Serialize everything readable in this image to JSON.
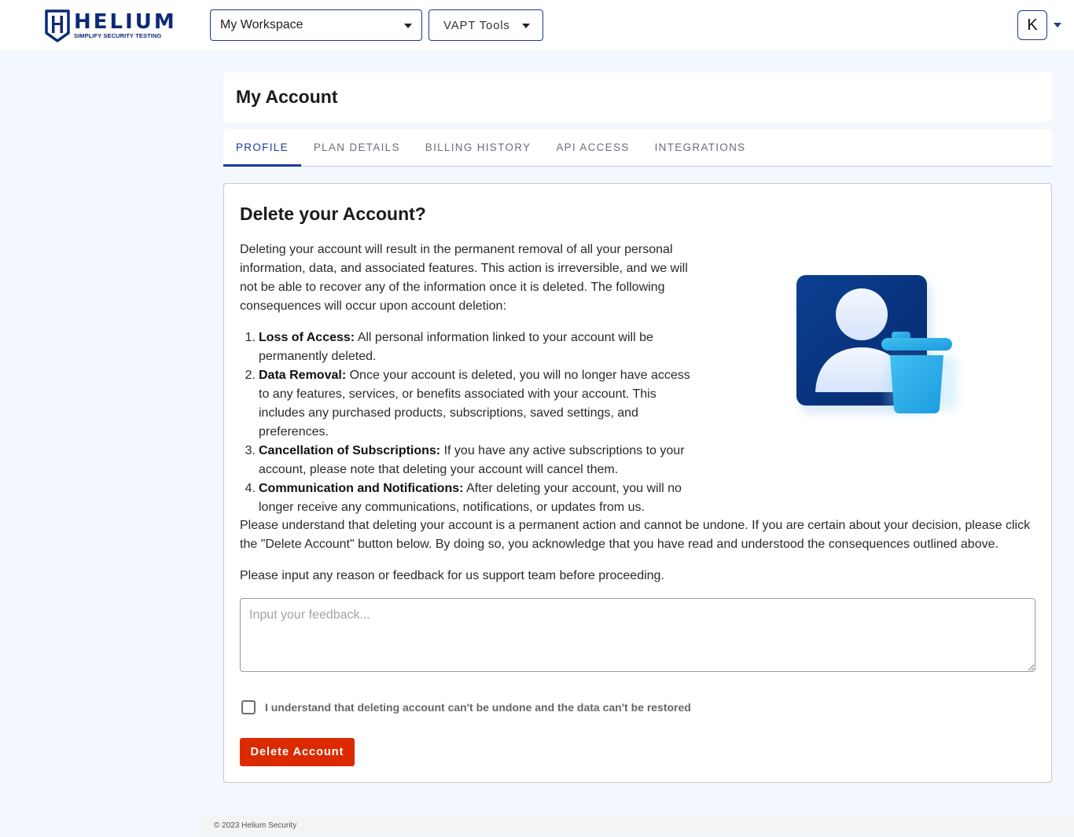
{
  "brand": {
    "name": "HELIUM",
    "tagline": "SIMPLIFY SECURITY TESTING",
    "primary_color": "#0d2a78"
  },
  "header": {
    "workspace_select": {
      "value": "My Workspace"
    },
    "tools_select": {
      "value": "VAPT Tools"
    },
    "user_avatar": {
      "initial": "K"
    }
  },
  "page": {
    "title": "My Account",
    "tabs": [
      {
        "label": "PROFILE",
        "active": true
      },
      {
        "label": "PLAN DETAILS",
        "active": false
      },
      {
        "label": "BILLING HISTORY",
        "active": false
      },
      {
        "label": "API ACCESS",
        "active": false
      },
      {
        "label": "INTEGRATIONS",
        "active": false
      }
    ]
  },
  "delete_section": {
    "title": "Delete your Account?",
    "intro": "Deleting your account will result in the permanent removal of all your personal information, data, and associated features. This action is irreversible, and we will not be able to recover any of the information once it is deleted. The following consequences will occur upon account deletion:",
    "consequences": [
      {
        "num": "1.",
        "heading": "Loss of Access:",
        "text": " All personal information linked to your account will be permanently deleted."
      },
      {
        "num": "2.",
        "heading": "Data Removal:",
        "text": " Once your account is deleted, you will no longer have access to any features, services, or benefits associated with your account. This includes any purchased products, subscriptions, saved settings, and preferences."
      },
      {
        "num": "3.",
        "heading": "Cancellation of Subscriptions:",
        "text": " If you have any active subscriptions to your account, please note that deleting your account will cancel them."
      },
      {
        "num": "4.",
        "heading": "Communication and Notifications:",
        "text": " After deleting your account, you will no longer receive any communications, notifications, or updates from us."
      }
    ],
    "warning": "Please understand that deleting your account is a permanent action and cannot be undone. If you are certain about your decision, please click the \"Delete Account\" button below. By doing so, you acknowledge that you have read and understood the consequences outlined above.",
    "feedback_prompt": "Please input any reason or feedback for us support team before proceeding.",
    "feedback": {
      "value": "",
      "placeholder": "Input your feedback..."
    },
    "confirm_checkbox": {
      "checked": false,
      "label": "I understand that deleting account can't be undone and the data can't be restored"
    },
    "delete_button": {
      "label": "Delete Account",
      "color": "#dc2a00"
    },
    "illustration": "user-delete-icon"
  },
  "footer": {
    "copyright": "© 2023 Helium Security"
  }
}
